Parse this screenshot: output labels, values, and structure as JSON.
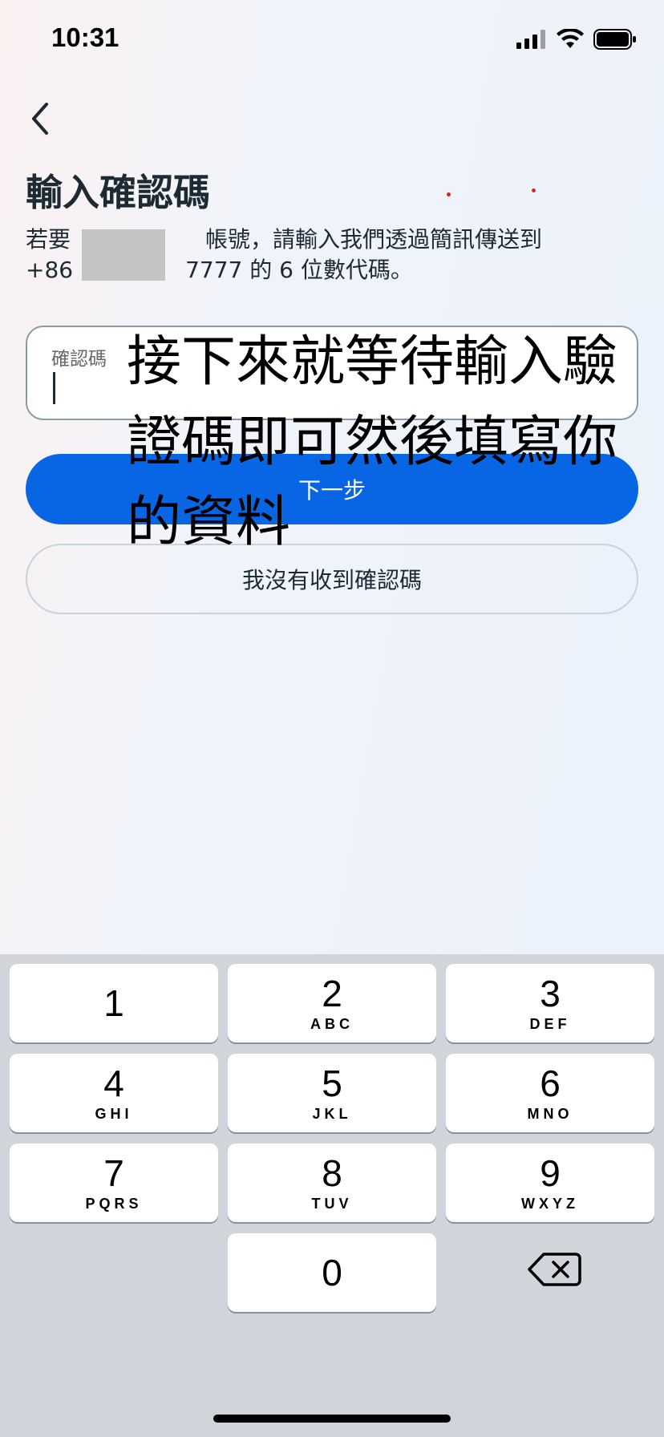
{
  "status_bar": {
    "time": "10:31"
  },
  "header": {
    "title": "輸入確認碼",
    "desc_line1": "若要　　　　　　帳號，請輸入我們透過簡訊傳送到",
    "desc_line2": "+86　　　　　7777 的 6 位數代碼。"
  },
  "form": {
    "code_label": "確認碼",
    "next_label": "下一步",
    "no_code_label": "我沒有收到確認碼"
  },
  "overlay_text": "接下來就等待輸入驗證碼即可然後填寫你的資料",
  "keyboard": {
    "keys": [
      {
        "num": "1",
        "letters": ""
      },
      {
        "num": "2",
        "letters": "ABC"
      },
      {
        "num": "3",
        "letters": "DEF"
      },
      {
        "num": "4",
        "letters": "GHI"
      },
      {
        "num": "5",
        "letters": "JKL"
      },
      {
        "num": "6",
        "letters": "MNO"
      },
      {
        "num": "7",
        "letters": "PQRS"
      },
      {
        "num": "8",
        "letters": "TUV"
      },
      {
        "num": "9",
        "letters": "WXYZ"
      },
      {
        "num": "0",
        "letters": ""
      }
    ]
  },
  "colors": {
    "primary": "#0866e4",
    "keyboard_bg": "#d1d4da"
  }
}
